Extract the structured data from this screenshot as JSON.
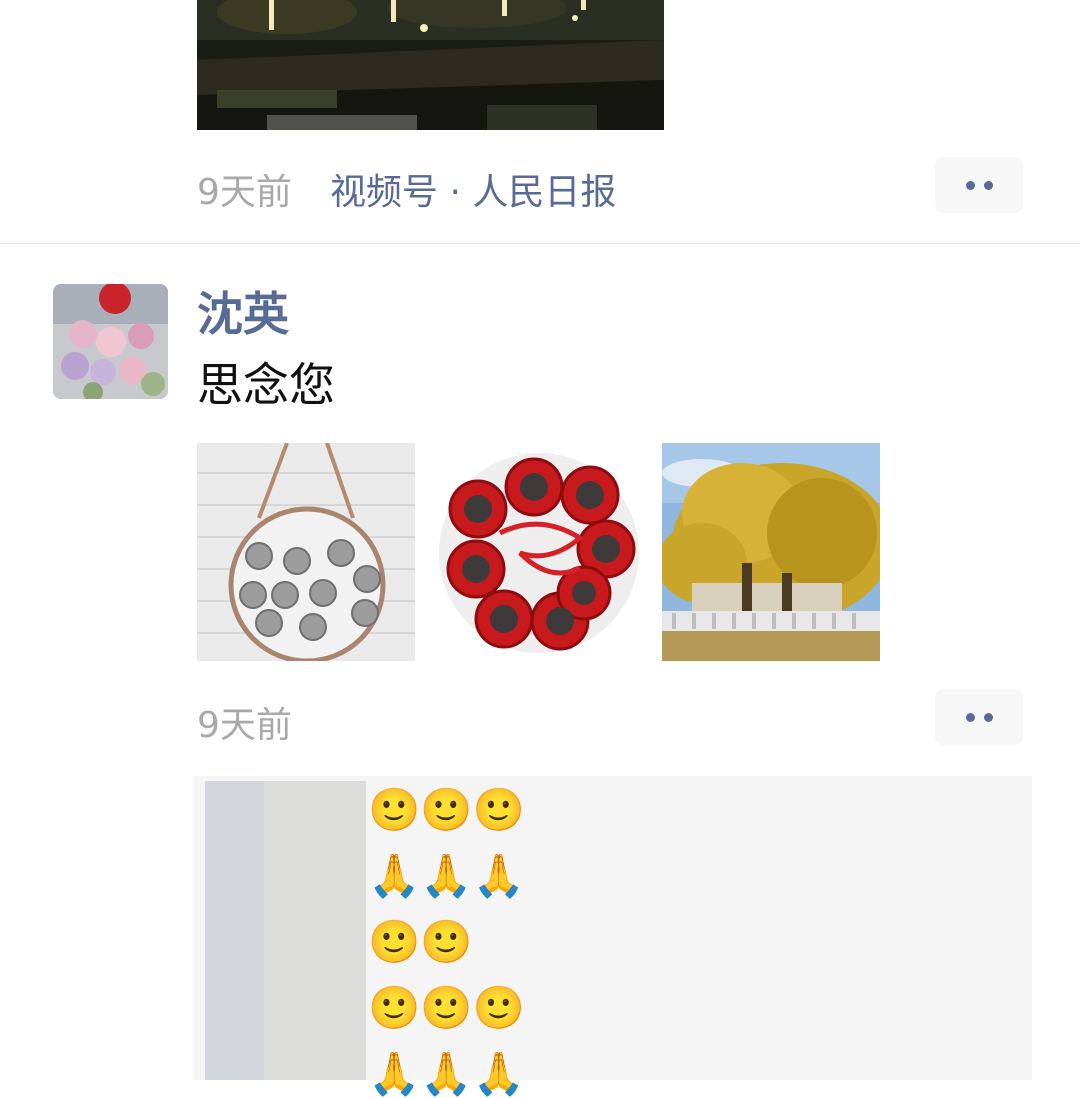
{
  "post_top": {
    "time": "9天前",
    "source": "视频号 · 人民日报"
  },
  "post_main": {
    "username": "沈英",
    "text": "思念您",
    "time": "9天前",
    "images": [
      "hanging-mirror-photo",
      "red-knot-ornament-photo",
      "ginkgo-tree-photo"
    ]
  },
  "comments": {
    "rows": [
      "🙂🙂🙂",
      "🙏🙏🙏",
      "🙂🙂",
      "🙂🙂🙂",
      "🙏🙏🙏"
    ]
  },
  "colors": {
    "link_blue": "#576b95",
    "time_gray": "#a9a9a9",
    "comment_bg": "#f5f5f5"
  }
}
